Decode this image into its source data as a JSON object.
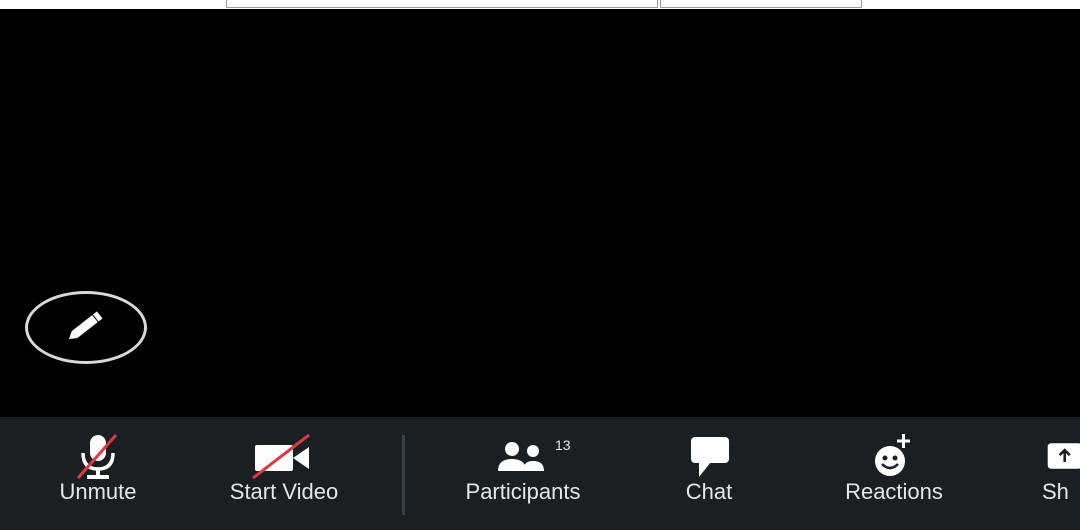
{
  "toolbar": {
    "items": [
      {
        "label": "Unmute",
        "icon": "microphone-muted-icon"
      },
      {
        "label": "Start Video",
        "icon": "video-off-icon"
      },
      {
        "label": "Participants",
        "icon": "participants-icon",
        "badge": "13"
      },
      {
        "label": "Chat",
        "icon": "chat-icon"
      },
      {
        "label": "Reactions",
        "icon": "reactions-icon"
      },
      {
        "label": "Sh",
        "icon": "share-icon"
      }
    ]
  },
  "annotate": {
    "icon": "pencil-icon"
  },
  "colors": {
    "toolbar_bg": "#1a1f24",
    "muted_slash": "#e0383b",
    "icon": "#ffffff",
    "label": "#e6e6e6"
  }
}
